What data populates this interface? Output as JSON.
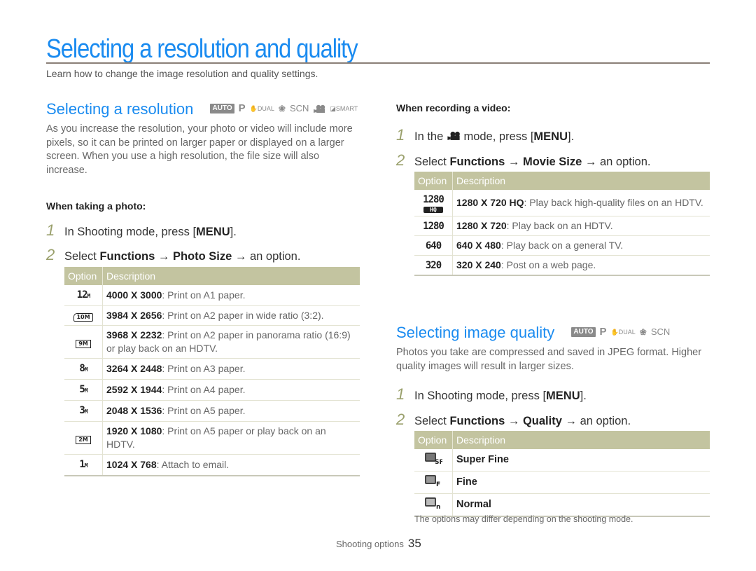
{
  "page": {
    "title": "Selecting a resolution and quality",
    "subtitle": "Learn how to change the image resolution and quality settings."
  },
  "resolution_section": {
    "title": "Selecting a resolution",
    "modes": [
      "AUTO",
      "P",
      "DUAL",
      "beauty",
      "SCN",
      "movie",
      "SMART"
    ],
    "mode_labels": {
      "auto": "AUTO",
      "p": "P",
      "dual": "DUAL",
      "scn": "SCN",
      "smart": "SMART"
    },
    "intro": "As you increase the resolution, your photo or video will include more pixels, so it can be printed on larger paper or displayed on a larger screen. When you use a high resolution, the file size will also increase.",
    "photo": {
      "label": "When taking a photo:",
      "steps": [
        {
          "num": "1",
          "pre": "In Shooting mode, press [",
          "key": "MENU",
          "post": "]."
        },
        {
          "num": "2",
          "pre": "Select ",
          "a": "Functions",
          "arrow1": " → ",
          "b": "Photo Size",
          "arrow2": " → ",
          "post": "an option."
        }
      ],
      "table": {
        "headers": {
          "option": "Option",
          "description": "Description"
        },
        "rows": [
          {
            "icon": "12M",
            "size": "4000 X 3000",
            "desc": ": Print on A1 paper."
          },
          {
            "icon": "10M",
            "size": "3984 X 2656",
            "desc": ": Print on A2 paper in wide ratio (3:2)."
          },
          {
            "icon": "9M",
            "size": "3968 X 2232",
            "desc": ": Print on A2 paper in panorama ratio (16:9) or play back on an HDTV."
          },
          {
            "icon": "8M",
            "size": "3264 X 2448",
            "desc": ": Print on A3 paper."
          },
          {
            "icon": "5M",
            "size": "2592 X 1944",
            "desc": ": Print on A4 paper."
          },
          {
            "icon": "3M",
            "size": "2048 X 1536",
            "desc": ": Print on A5 paper."
          },
          {
            "icon": "2M",
            "size": "1920 X 1080",
            "desc": ": Print on A5 paper or play back on an HDTV."
          },
          {
            "icon": "1M",
            "size": "1024 X 768",
            "desc": ": Attach to email."
          }
        ]
      }
    },
    "video": {
      "label": "When recording a video:",
      "steps": [
        {
          "num": "1",
          "pre": "In the ",
          "mid": " mode, press [",
          "key": "MENU",
          "post": "]."
        },
        {
          "num": "2",
          "pre": "Select ",
          "a": "Functions",
          "arrow1": " → ",
          "b": "Movie Size",
          "arrow2": " → ",
          "post": "an option."
        }
      ],
      "table": {
        "headers": {
          "option": "Option",
          "description": "Description"
        },
        "rows": [
          {
            "icon": "1280",
            "badge": "HQ",
            "size": "1280 X 720 HQ",
            "desc": ": Play back high-quality files on an HDTV."
          },
          {
            "icon": "1280",
            "size": "1280 X 720",
            "desc": ": Play back on an HDTV."
          },
          {
            "icon": "640",
            "size": "640 X 480",
            "desc": ": Play back on a general TV."
          },
          {
            "icon": "320",
            "size": "320 X 240",
            "desc": ": Post on a web page."
          }
        ]
      }
    }
  },
  "quality_section": {
    "title": "Selecting image quality",
    "modes": [
      "AUTO",
      "P",
      "DUAL",
      "beauty",
      "SCN"
    ],
    "mode_labels": {
      "auto": "AUTO",
      "p": "P",
      "dual": "DUAL",
      "scn": "SCN"
    },
    "intro": "Photos you take are compressed and saved in JPEG format. Higher quality images will result in larger sizes.",
    "steps": [
      {
        "num": "1",
        "pre": "In Shooting mode, press [",
        "key": "MENU",
        "post": "]."
      },
      {
        "num": "2",
        "pre": "Select ",
        "a": "Functions",
        "arrow1": " → ",
        "b": "Quality",
        "arrow2": " → ",
        "post": "an option."
      }
    ],
    "table": {
      "headers": {
        "option": "Option",
        "description": "Description"
      },
      "rows": [
        {
          "icon": "SF",
          "name": "Super Fine"
        },
        {
          "icon": "F",
          "name": "Fine"
        },
        {
          "icon": "N",
          "name": "Normal"
        }
      ]
    },
    "note": "The options may differ depending on the shooting mode."
  },
  "footer": {
    "section": "Shooting options",
    "page_number": "35"
  },
  "colors": {
    "accent": "#1a8bf0",
    "table_header": "#c3c4a0",
    "step_number": "#9aa06c",
    "rule": "#8a7f77"
  }
}
